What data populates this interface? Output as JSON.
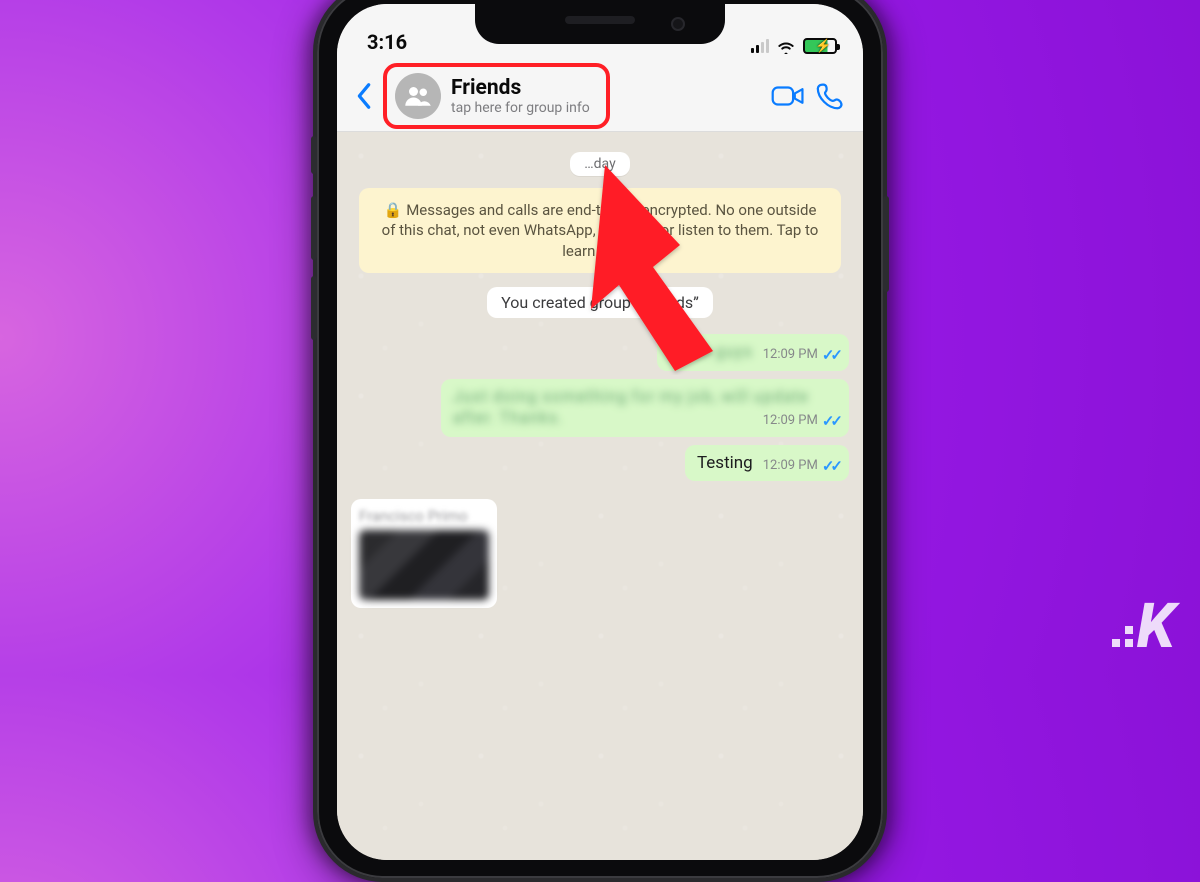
{
  "statusbar": {
    "time": "3:16"
  },
  "navbar": {
    "title": "Friends",
    "subtitle": "tap here for group info"
  },
  "chat": {
    "date_pill": "…day",
    "encryption_text": "Messages and calls are end-to-end encrypted. No one outside of this chat, not even WhatsApp, can read or listen to them. Tap to learn more.",
    "system_pill": "You created group “Friends”",
    "messages": [
      {
        "side": "sent",
        "text": "Hello guys",
        "time": "12:09 PM",
        "blurred": true
      },
      {
        "side": "sent",
        "text": "Just doing something for my job, will update after. Thanks.",
        "time": "12:09 PM",
        "blurred": true
      },
      {
        "side": "sent",
        "text": "Testing",
        "time": "12:09 PM",
        "blurred": false
      }
    ],
    "received": {
      "sender": "Francisco Primo",
      "time": ""
    }
  }
}
